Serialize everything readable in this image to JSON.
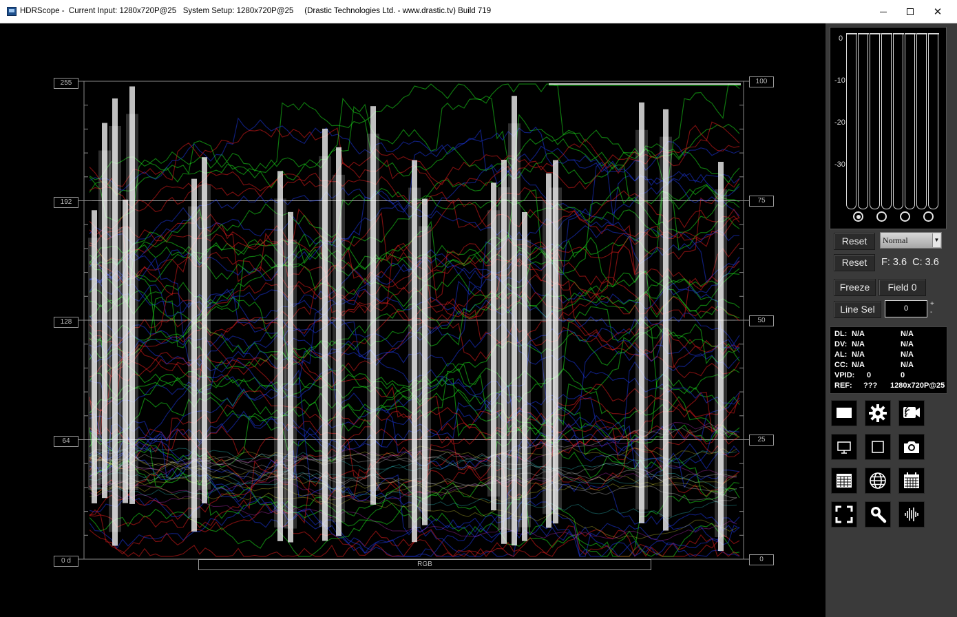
{
  "titlebar": {
    "title": "HDRScope -  Current Input: 1280x720P@25   System Setup: 1280x720P@25     (Drastic Technologies Ltd. - www.drastic.tv) Build 719"
  },
  "scope": {
    "left_axis": [
      "255",
      "192",
      "128",
      "64",
      "0 d"
    ],
    "right_axis": [
      "100",
      "75",
      "50",
      "25",
      "0"
    ],
    "mode_label": "RGB",
    "trace_colors": [
      "#ff2020",
      "#20ff20",
      "#2040ff",
      "#ffffff",
      "#ffff40",
      "#40ffff",
      "#ff40ff"
    ]
  },
  "panel": {
    "meter_scale": [
      "0",
      "-10",
      "-20",
      "-30"
    ],
    "meter_channels": 8,
    "radio_selected": 0,
    "reset1_label": "Reset",
    "mode_select": "Normal",
    "reset2_label": "Reset",
    "fc_text": "F: 3.6  C: 3.6",
    "freeze_label": "Freeze",
    "field_label": "Field 0",
    "linesel_label": "Line Sel",
    "linesel_value": "0",
    "plus": "+",
    "minus": "-",
    "info": [
      {
        "key": "DL:",
        "v1": "N/A",
        "v2": "N/A"
      },
      {
        "key": "DV:",
        "v1": "N/A",
        "v2": "N/A"
      },
      {
        "key": "AL:",
        "v1": "N/A",
        "v2": "N/A"
      },
      {
        "key": "CC:",
        "v1": "N/A",
        "v2": "N/A"
      },
      {
        "key": "VPID:",
        "v1": "0",
        "v2": "0"
      },
      {
        "key": "REF:",
        "v1": "???",
        "v2": "1280x720P@25"
      }
    ],
    "icons": [
      "rectangle-icon",
      "gear-icon",
      "cast-icon",
      "monitor-icon",
      "square-icon",
      "camera-icon",
      "grid-icon",
      "globe-icon",
      "calendar-icon",
      "fullscreen-icon",
      "search-icon",
      "waveform-icon"
    ]
  }
}
